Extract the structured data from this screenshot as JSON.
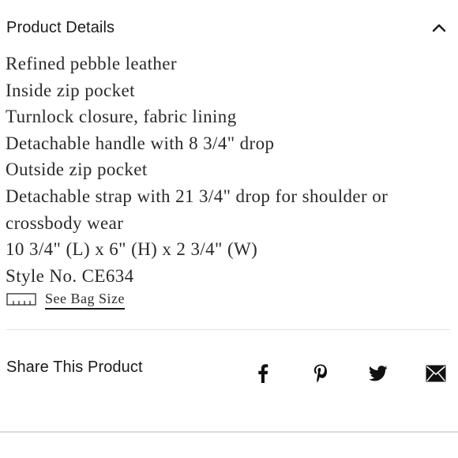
{
  "product_details": {
    "title": "Product Details",
    "toggle_icon": "chevron-up-icon",
    "lines": [
      "Refined pebble leather",
      "Inside zip pocket",
      "Turnlock closure, fabric lining",
      "Detachable handle with 8 3/4\" drop",
      "Outside zip pocket",
      "Detachable strap with 21 3/4\" drop for shoulder or crossbody wear",
      "10 3/4\" (L) x 6\" (H) x 2 3/4\" (W)",
      "Style No. CE634"
    ],
    "bag_size": {
      "icon": "ruler-icon",
      "label": "See Bag Size"
    }
  },
  "share": {
    "title": "Share This Product",
    "icons": [
      "facebook-icon",
      "pinterest-icon",
      "twitter-icon",
      "email-icon"
    ]
  },
  "colors": {
    "text": "#1a1a1a",
    "divider": "#e2e2e2",
    "background": "#ffffff"
  }
}
